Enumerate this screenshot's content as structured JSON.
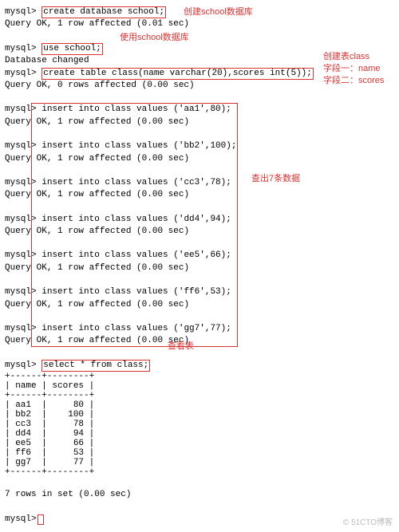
{
  "prompt": "mysql>",
  "cmd_create_db": "create database school;",
  "resp_create_db": "Query OK, 1 row affected (0.01 sec)",
  "cmd_use": "use school;",
  "resp_use": "Database changed",
  "cmd_create_table": "create table class(name varchar(20),scores int(5));",
  "resp_create_table": "Query OK, 0 rows affected (0.00 sec)",
  "inserts": [
    {
      "cmd": "insert into class values ('aa1',80);",
      "resp": "OK, 1 row affected (0.00 sec)"
    },
    {
      "cmd": "insert into class values ('bb2',100);",
      "resp": "OK, 1 row affected (0.00 sec)"
    },
    {
      "cmd": "insert into class values ('cc3',78);",
      "resp": "OK, 1 row affected (0.00 sec)"
    },
    {
      "cmd": "insert into class values ('dd4',94);",
      "resp": "OK, 1 row affected (0.00 sec)"
    },
    {
      "cmd": "insert into class values ('ee5',66);",
      "resp": "OK, 1 row affected (0.00 sec)"
    },
    {
      "cmd": "insert into class values ('ff6',53);",
      "resp": "OK, 1 row affected (0.00 sec)"
    },
    {
      "cmd": "insert into class values ('gg7',77);",
      "resp": "OK, 1 row affected (0.00 sec)"
    }
  ],
  "cmd_select": "select * from class;",
  "table": {
    "border": "+------+--------+",
    "header": "| name | scores |",
    "rows": [
      "| aa1  |     80 |",
      "| bb2  |    100 |",
      "| cc3  |     78 |",
      "| dd4  |     94 |",
      "| ee5  |     66 |",
      "| ff6  |     53 |",
      "| gg7  |     77 |"
    ],
    "footer": "7 rows in set (0.00 sec)"
  },
  "ann": {
    "create_db": "创建school数据库",
    "use_school": "使用school数据库",
    "create_table1": "创建表class",
    "create_table2": "字段一：name",
    "create_table3": "字段二：scores",
    "insert7": "查出7条数据",
    "select": "查看表"
  },
  "watermark": "© 51CTO博客"
}
